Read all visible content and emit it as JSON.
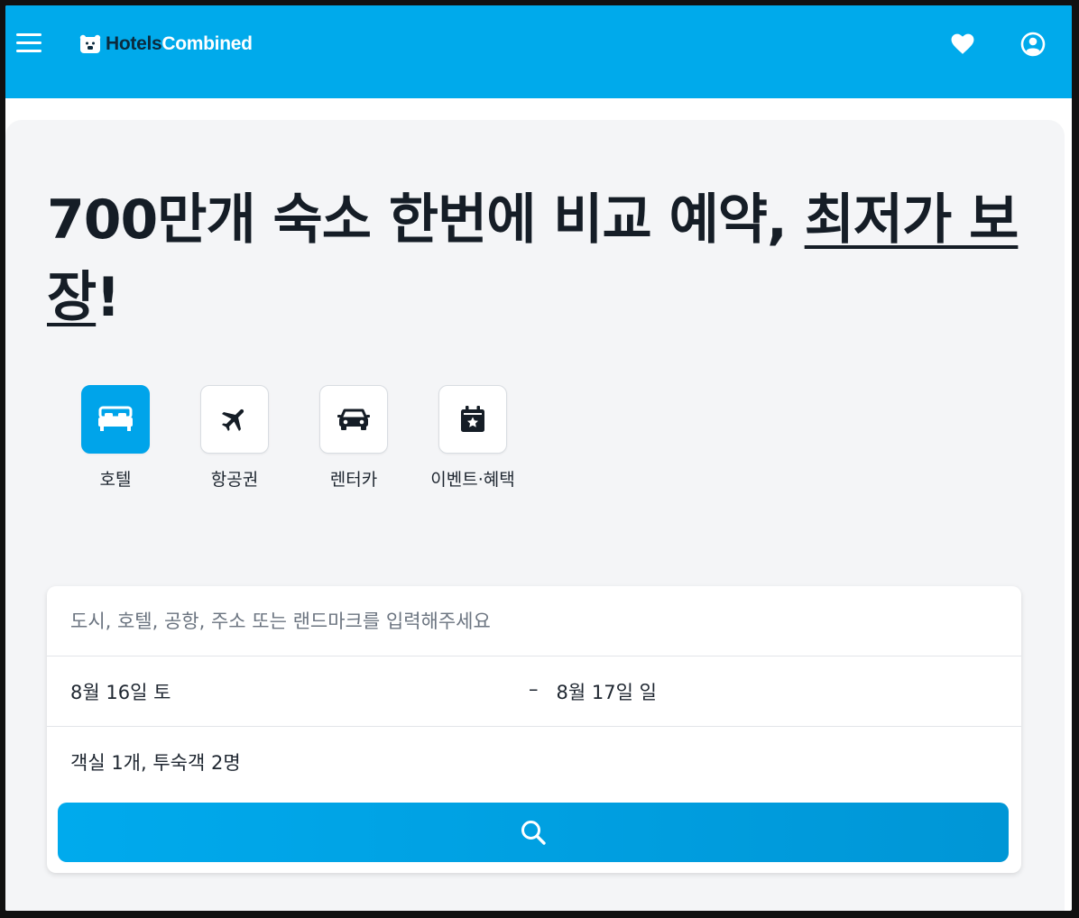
{
  "brand": {
    "name_part1": "Hotels",
    "name_part2": "Combined",
    "primary_color": "#00aaeb",
    "dark_color": "#0b2a3d"
  },
  "header": {
    "menu_icon": "hamburger-icon",
    "favorites_icon": "heart-icon",
    "account_icon": "user-icon"
  },
  "headline": {
    "part1": "700만개 숙소 한번에 비교 예약, ",
    "underlined": "최저가 보장",
    "exclaim": "!"
  },
  "verticals": [
    {
      "label": "호텔",
      "icon": "bed-icon",
      "active": true
    },
    {
      "label": "항공권",
      "icon": "airplane-icon",
      "active": false
    },
    {
      "label": "렌터카",
      "icon": "car-icon",
      "active": false
    },
    {
      "label": "이벤트·혜택",
      "icon": "calendar-star-icon",
      "active": false
    }
  ],
  "search": {
    "destination_placeholder": "도시, 호텔, 공항, 주소 또는 랜드마크를 입력해주세요",
    "checkin": "8월 16일 토",
    "separator": "–",
    "checkout": "8월 17일 일",
    "guests": "객실 1개, 투숙객 2명",
    "button_icon": "search-icon"
  }
}
